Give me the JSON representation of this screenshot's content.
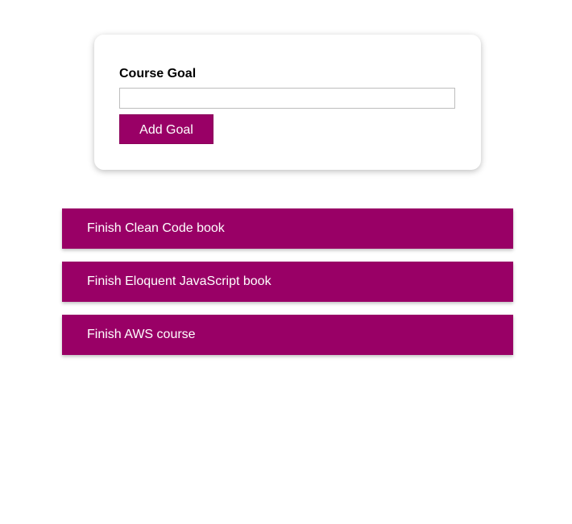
{
  "form": {
    "label": "Course Goal",
    "input_value": "",
    "button_label": "Add Goal"
  },
  "goals": [
    {
      "text": "Finish Clean Code book"
    },
    {
      "text": "Finish Eloquent JavaScript book"
    },
    {
      "text": "Finish AWS course"
    }
  ],
  "colors": {
    "accent": "#990066",
    "accent_text": "#ffffff"
  }
}
